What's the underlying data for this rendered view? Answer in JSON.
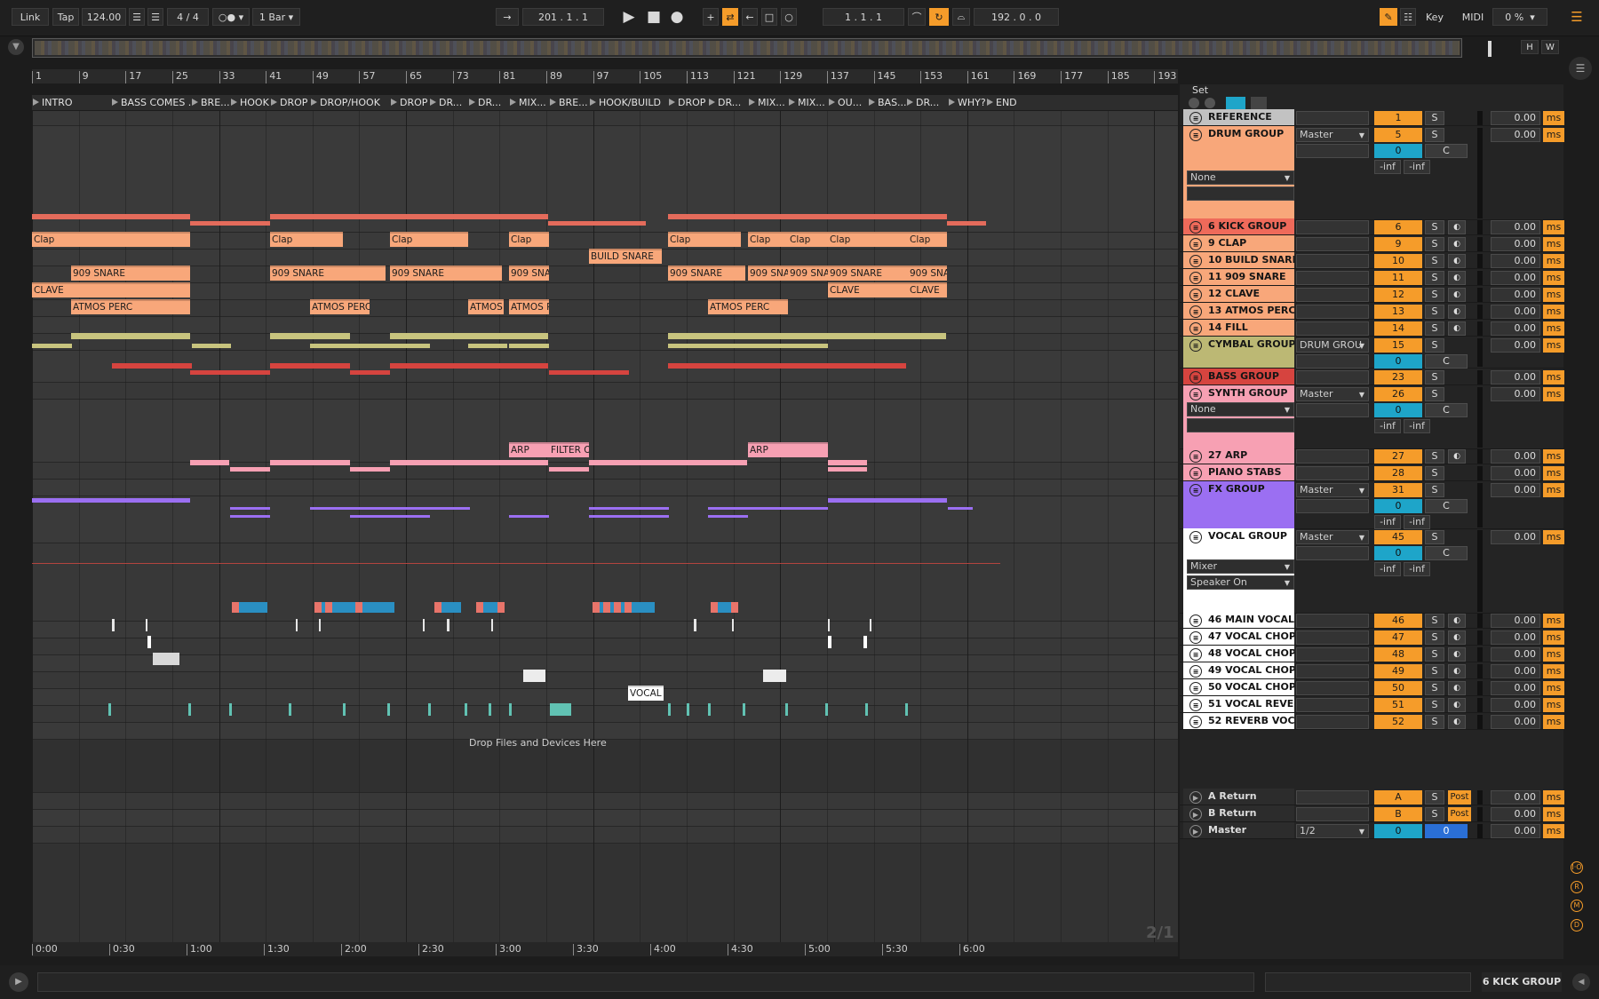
{
  "transport": {
    "link": "Link",
    "tap": "Tap",
    "tempo": "124.00",
    "signature": "4 / 4",
    "quantize": "1 Bar",
    "arrangement_position": "201 .  1 .  1",
    "loop_start": "1 .  1 .  1",
    "loop_length": "192 .  0 .  0",
    "key_label": "Key",
    "midi_label": "MIDI",
    "cpu": "0 %"
  },
  "overview": {
    "h": "H",
    "w": "W"
  },
  "ruler_marks": [
    "1",
    "9",
    "17",
    "25",
    "33",
    "41",
    "49",
    "57",
    "65",
    "73",
    "81",
    "89",
    "97",
    "105",
    "113",
    "121",
    "129",
    "137",
    "145",
    "153",
    "161",
    "169",
    "177",
    "185",
    "193"
  ],
  "locators": [
    "INTRO",
    "BASS COMES ...",
    "BRE...",
    "HOOK",
    "DROP",
    "DROP/HOOK",
    "DROP",
    "DR...",
    "DR...",
    "MIX...",
    "BRE...",
    "HOOK/BUILD",
    "DROP",
    "DR...",
    "MIX...",
    "MIX...",
    "OU...",
    "BAS...",
    "DR...",
    "WHY?",
    "END"
  ],
  "clip_labels": [
    "Clap",
    "Clap",
    "Clap",
    "Clap",
    "Clap",
    "Clap",
    "Clap",
    "Clap",
    "Clap",
    "BUILD SNARE",
    "909 SNARE",
    "909 SNARE",
    "909 SNARE",
    "909 SNA",
    "909 SNARE",
    "909 SNA",
    "909 SNA",
    "909 SNARE",
    "909 SNA",
    "CLAVE",
    "CLAVE",
    "CLAVE",
    "ATMOS PERC",
    "ATMOS PERC",
    "ATMOS",
    "ATMOS P",
    "ATMOS PERC",
    "ARP",
    "FILTER O",
    "ARP",
    "VOCAL C"
  ],
  "drop_text": "Drop Files and Devices Here",
  "time_marks": [
    "0:00",
    "0:30",
    "1:00",
    "1:30",
    "2:00",
    "2:30",
    "3:00",
    "3:30",
    "4:00",
    "4:30",
    "5:00",
    "5:30",
    "6:00"
  ],
  "page_indicator": "2/1",
  "mixer": {
    "set_label": "Set",
    "tracks": [
      {
        "name": "REFERENCE",
        "num": "1",
        "s": "S",
        "delay": "0.00",
        "ms": "ms",
        "color": "#c2c2c2"
      },
      {
        "name": "DRUM GROUP",
        "io": "Master",
        "num": "5",
        "s": "S",
        "pan": "0",
        "c": "C",
        "inf1": "-inf",
        "inf2": "-inf",
        "chain": "None",
        "delay": "0.00",
        "ms": "ms",
        "color": "#f8a77a"
      },
      {
        "name": "6 KICK GROUP",
        "num": "6",
        "s": "S",
        "delay": "0.00",
        "ms": "ms",
        "color": "#ef6a5a"
      },
      {
        "name": "9 CLAP",
        "num": "9",
        "s": "S",
        "delay": "0.00",
        "ms": "ms",
        "color": "#f8a77a"
      },
      {
        "name": "10 BUILD SNARE",
        "num": "10",
        "s": "S",
        "delay": "0.00",
        "ms": "ms",
        "color": "#f8a77a"
      },
      {
        "name": "11 909 SNARE",
        "num": "11",
        "s": "S",
        "delay": "0.00",
        "ms": "ms",
        "color": "#f8a77a"
      },
      {
        "name": "12 CLAVE",
        "num": "12",
        "s": "S",
        "delay": "0.00",
        "ms": "ms",
        "color": "#f8a77a"
      },
      {
        "name": "13 ATMOS PERC",
        "num": "13",
        "s": "S",
        "delay": "0.00",
        "ms": "ms",
        "color": "#f8a77a"
      },
      {
        "name": "14 FILL",
        "num": "14",
        "s": "S",
        "delay": "0.00",
        "ms": "ms",
        "color": "#f8a77a"
      },
      {
        "name": "CYMBAL GROUP",
        "io": "DRUM GROU",
        "num": "15",
        "s": "S",
        "pan": "0",
        "c": "C",
        "delay": "0.00",
        "ms": "ms",
        "color": "#bcb874"
      },
      {
        "name": "BASS GROUP",
        "num": "23",
        "s": "S",
        "delay": "0.00",
        "ms": "ms",
        "color": "#d6443f"
      },
      {
        "name": "SYNTH GROUP",
        "io": "Master",
        "num": "26",
        "s": "S",
        "pan": "0",
        "c": "C",
        "inf1": "-inf",
        "inf2": "-inf",
        "chain": "None",
        "delay": "0.00",
        "ms": "ms",
        "color": "#f7a0b3"
      },
      {
        "name": "27 ARP",
        "num": "27",
        "s": "S",
        "delay": "0.00",
        "ms": "ms",
        "color": "#f7a0b3"
      },
      {
        "name": "PIANO STABS",
        "num": "28",
        "s": "S",
        "delay": "0.00",
        "ms": "ms",
        "color": "#f7a0b3"
      },
      {
        "name": "FX GROUP",
        "io": "Master",
        "num": "31",
        "s": "S",
        "pan": "0",
        "c": "C",
        "inf1": "-inf",
        "inf2": "-inf",
        "delay": "0.00",
        "ms": "ms",
        "color": "#9b6ff2"
      },
      {
        "name": "VOCAL GROUP",
        "io": "Master",
        "num": "45",
        "s": "S",
        "pan": "0",
        "c": "C",
        "inf1": "-inf",
        "inf2": "-inf",
        "chain1": "Mixer",
        "chain2": "Speaker On",
        "delay": "0.00",
        "ms": "ms",
        "color": "#ffffff"
      },
      {
        "name": "46 MAIN VOCAL",
        "num": "46",
        "s": "S",
        "delay": "0.00",
        "ms": "ms",
        "color": "#ffffff"
      },
      {
        "name": "47 VOCAL CHOP",
        "num": "47",
        "s": "S",
        "delay": "0.00",
        "ms": "ms",
        "color": "#ffffff"
      },
      {
        "name": "48 VOCAL CHOP",
        "num": "48",
        "s": "S",
        "delay": "0.00",
        "ms": "ms",
        "color": "#ffffff"
      },
      {
        "name": "49 VOCAL CHOP",
        "num": "49",
        "s": "S",
        "delay": "0.00",
        "ms": "ms",
        "color": "#ffffff"
      },
      {
        "name": "50 VOCAL CHOP",
        "num": "50",
        "s": "S",
        "delay": "0.00",
        "ms": "ms",
        "color": "#ffffff"
      },
      {
        "name": "51 VOCAL REVE",
        "num": "51",
        "s": "S",
        "delay": "0.00",
        "ms": "ms",
        "color": "#ffffff"
      },
      {
        "name": "52 REVERB VOC",
        "num": "52",
        "s": "S",
        "delay": "0.00",
        "ms": "ms",
        "color": "#ffffff"
      }
    ],
    "returns": [
      {
        "name": "A Return",
        "num": "A",
        "s": "S",
        "post": "Post",
        "delay": "0.00",
        "ms": "ms"
      },
      {
        "name": "B Return",
        "num": "B",
        "s": "S",
        "post": "Post",
        "delay": "0.00",
        "ms": "ms"
      }
    ],
    "master": {
      "name": "Master",
      "io": "1/2",
      "num": "0",
      "pan": "0",
      "delay": "0.00",
      "ms": "ms"
    }
  },
  "status": {
    "selected_track": "6 KICK GROUP"
  }
}
